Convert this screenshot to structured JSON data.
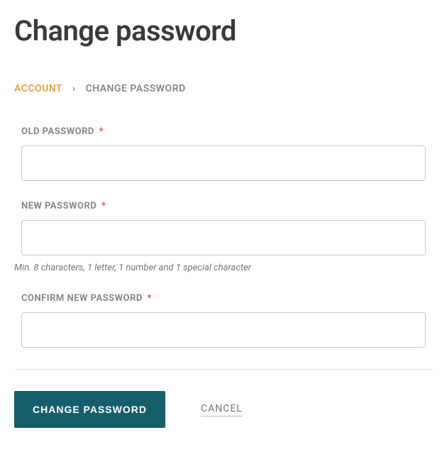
{
  "header": {
    "title": "Change password"
  },
  "breadcrumb": {
    "parent": "ACCOUNT",
    "separator": "›",
    "current": "CHANGE PASSWORD"
  },
  "form": {
    "old_password": {
      "label": "OLD PASSWORD",
      "required_mark": "*",
      "value": ""
    },
    "new_password": {
      "label": "NEW PASSWORD",
      "required_mark": "*",
      "value": "",
      "hint": "Min. 8 characters, 1 letter, 1 number and 1 special character"
    },
    "confirm_password": {
      "label": "CONFIRM NEW PASSWORD",
      "required_mark": "*",
      "value": ""
    }
  },
  "actions": {
    "submit_label": "CHANGE PASSWORD",
    "cancel_label": "CANCEL"
  }
}
